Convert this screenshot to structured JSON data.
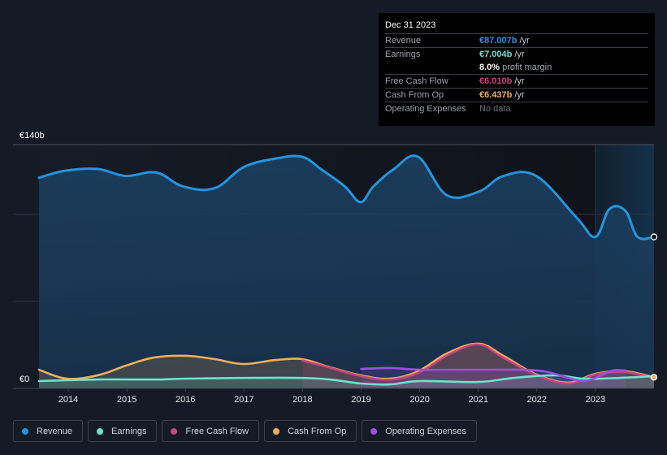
{
  "tooltip": {
    "date": "Dec 31 2023",
    "rows": [
      {
        "label": "Revenue",
        "value": "€87.007b",
        "unit": "/yr",
        "color": "#2394df"
      },
      {
        "label": "Earnings",
        "value": "€7.004b",
        "unit": "/yr",
        "color": "#6be3cd"
      },
      {
        "label": "",
        "value": "8.0%",
        "unit": "profit margin",
        "color": "#ffffff"
      },
      {
        "label": "Free Cash Flow",
        "value": "€6.010b",
        "unit": "/yr",
        "color": "#c8447f"
      },
      {
        "label": "Cash From Op",
        "value": "€6.437b",
        "unit": "/yr",
        "color": "#efae5b"
      },
      {
        "label": "Operating Expenses",
        "value": "No data",
        "unit": "",
        "color": "#6c737c"
      }
    ]
  },
  "legend": [
    {
      "label": "Revenue",
      "color": "#2394df"
    },
    {
      "label": "Earnings",
      "color": "#6be3cd"
    },
    {
      "label": "Free Cash Flow",
      "color": "#c8447f"
    },
    {
      "label": "Cash From Op",
      "color": "#efae5b"
    },
    {
      "label": "Operating Expenses",
      "color": "#9d4ee6"
    }
  ],
  "chart_data": {
    "type": "area",
    "title": "",
    "xlabel": "",
    "ylabel": "",
    "currency": "€",
    "unit": "b",
    "y_tick_labels": [
      "€140b",
      "€0"
    ],
    "ylim": [
      0,
      140
    ],
    "xlim": [
      2013.5,
      2024.0
    ],
    "x_tick_labels": [
      "2014",
      "2015",
      "2016",
      "2017",
      "2018",
      "2019",
      "2020",
      "2021",
      "2022",
      "2023"
    ],
    "x_ticks": [
      2014,
      2015,
      2016,
      2017,
      2018,
      2019,
      2020,
      2021,
      2022,
      2023
    ],
    "highlight_range": [
      2023.0,
      2024.0
    ],
    "grid": true,
    "legend_position": "bottom",
    "series": [
      {
        "name": "Revenue",
        "color": "#2394df",
        "x": [
          2013.5,
          2013.95,
          2014.5,
          2014.98,
          2015.5,
          2015.96,
          2016.5,
          2016.99,
          2017.54,
          2017.99,
          2018.31,
          2018.72,
          2018.99,
          2019.21,
          2019.56,
          2019.97,
          2020.46,
          2021.01,
          2021.43,
          2021.99,
          2022.68,
          2023.0,
          2023.24,
          2023.51,
          2023.72,
          2024.0
        ],
        "values": [
          121,
          125,
          126,
          122,
          124,
          116,
          115,
          127,
          132,
          133,
          126,
          116,
          107,
          116,
          126,
          133,
          111,
          113,
          122,
          122,
          98,
          87,
          103,
          102,
          87,
          87
        ]
      },
      {
        "name": "Earnings",
        "color": "#6be3cd",
        "x": [
          2013.5,
          2014.5,
          2015.5,
          2016.0,
          2017.0,
          2018.0,
          2018.5,
          2019.0,
          2019.5,
          2020.0,
          2021.0,
          2021.6,
          2022.3,
          2022.8,
          2023.4,
          2024.0
        ],
        "values": [
          4.2,
          5.1,
          5.1,
          5.6,
          6.0,
          6.0,
          5.0,
          2.8,
          2.3,
          4.2,
          3.7,
          6.0,
          7.5,
          5.6,
          6.0,
          7.0
        ]
      },
      {
        "name": "Free Cash Flow",
        "color": "#c8447f",
        "x": [
          2018.0,
          2018.4,
          2019.0,
          2019.5,
          2020.0,
          2020.5,
          2021.0,
          2021.4,
          2022.0,
          2022.55,
          2023.0,
          2023.5,
          2024.0
        ],
        "values": [
          16.0,
          12.5,
          7.0,
          5.0,
          9.3,
          19.5,
          25.2,
          18.2,
          7.5,
          2.8,
          8.0,
          9.3,
          6.0
        ]
      },
      {
        "name": "Cash From Op",
        "color": "#efae5b",
        "x": [
          2013.5,
          2013.97,
          2014.5,
          2014.98,
          2015.46,
          2016.01,
          2016.5,
          2016.99,
          2017.54,
          2017.99,
          2018.38,
          2018.99,
          2019.49,
          2019.97,
          2020.46,
          2021.0,
          2021.43,
          2021.99,
          2022.54,
          2023.0,
          2023.51,
          2024.0
        ],
        "values": [
          10.7,
          5.6,
          7.5,
          13.0,
          17.7,
          18.7,
          16.8,
          14.0,
          16.3,
          16.8,
          13.0,
          7.5,
          5.6,
          9.8,
          20.0,
          25.7,
          18.7,
          8.0,
          3.3,
          8.4,
          9.8,
          6.4
        ]
      },
      {
        "name": "Operating Expenses",
        "color": "#9d4ee6",
        "x": [
          2019.0,
          2019.5,
          2020.04,
          2021.0,
          2022.0,
          2022.54,
          2022.82,
          2023.1,
          2023.3,
          2023.51
        ],
        "values": [
          11.2,
          11.7,
          10.7,
          10.7,
          10.3,
          6.0,
          4.2,
          7.5,
          10.3,
          10.3
        ]
      }
    ]
  }
}
